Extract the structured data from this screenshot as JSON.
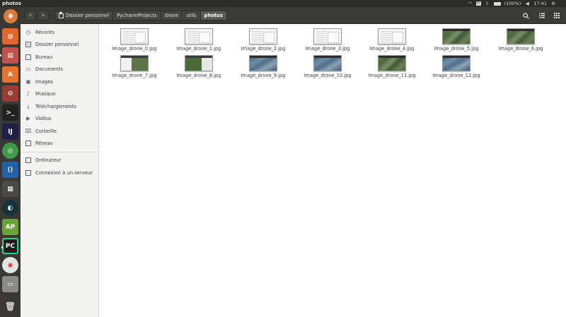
{
  "window": {
    "title": "photos"
  },
  "panel": {
    "keyboard": "Fr",
    "battery": "(100%)",
    "clock": "17:41"
  },
  "breadcrumb": [
    {
      "label": "Dossier personnel",
      "icon": "home-icon"
    },
    {
      "label": "PycharmProjects"
    },
    {
      "label": "drone"
    },
    {
      "label": "utils"
    },
    {
      "label": "photos"
    }
  ],
  "sidebar": {
    "items": [
      {
        "label": "Récents",
        "icon": "clock-icon"
      },
      {
        "label": "Dossier personnel",
        "icon": "home-icon"
      },
      {
        "label": "Bureau",
        "icon": "desktop-icon"
      },
      {
        "label": "Documents",
        "icon": "documents-icon"
      },
      {
        "label": "Images",
        "icon": "images-icon"
      },
      {
        "label": "Musique",
        "icon": "music-icon"
      },
      {
        "label": "Téléchargements",
        "icon": "download-icon"
      },
      {
        "label": "Vidéos",
        "icon": "video-icon"
      },
      {
        "label": "Corbeille",
        "icon": "trash-icon"
      },
      {
        "label": "Réseau",
        "icon": "network-icon"
      }
    ],
    "devices": [
      {
        "label": "Ordinateur",
        "icon": "computer-icon"
      },
      {
        "label": "Connexion à un serveur",
        "icon": "server-icon"
      }
    ]
  },
  "files": [
    {
      "name": "Image_drone_0.jpg",
      "thumb": "doc"
    },
    {
      "name": "Image_drone_1.jpg",
      "thumb": "doc"
    },
    {
      "name": "Image_drone_2.jpg",
      "thumb": "doc"
    },
    {
      "name": "Image_drone_3.jpg",
      "thumb": "doc"
    },
    {
      "name": "Image_drone_4.jpg",
      "thumb": "doc"
    },
    {
      "name": "Image_drone_5.jpg",
      "thumb": "aerial"
    },
    {
      "name": "Image_drone_6.jpg",
      "thumb": "aerial"
    },
    {
      "name": "Image_drone_7.jpg",
      "thumb": "mixed"
    },
    {
      "name": "Image_drone_8.jpg",
      "thumb": "mixed2"
    },
    {
      "name": "Image_drone_9.jpg",
      "thumb": "city"
    },
    {
      "name": "Image_drone_10.jpg",
      "thumb": "city"
    },
    {
      "name": "Image_drone_11.jpg",
      "thumb": "aerial"
    },
    {
      "name": "Image_drone_12.jpg",
      "thumb": "city"
    }
  ]
}
